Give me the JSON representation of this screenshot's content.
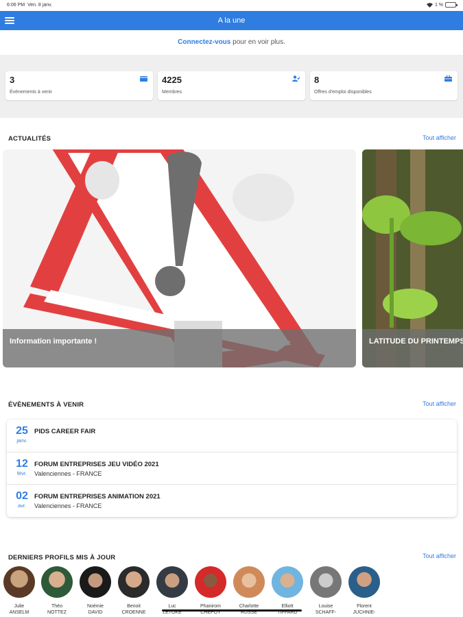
{
  "status_bar": {
    "time": "6:06 PM",
    "date": "Ven. 8 janv.",
    "battery": "1 %"
  },
  "header": {
    "title": "A la une"
  },
  "login": {
    "link": "Connectez-vous",
    "suffix": " pour en voir plus."
  },
  "stats": [
    {
      "value": "3",
      "label": "Évènements à venir",
      "icon": "calendar-icon"
    },
    {
      "value": "4225",
      "label": "Membres",
      "icon": "members-icon"
    },
    {
      "value": "8",
      "label": "Offres d'emploi disponibles",
      "icon": "briefcase-icon"
    }
  ],
  "news": {
    "title": "ACTUALITÉS",
    "see_all": "Tout afficher",
    "items": [
      {
        "caption": "Information importante !"
      },
      {
        "caption": "LATITUDE DU PRINTEMPS"
      }
    ]
  },
  "events": {
    "title": "ÉVÈNEMENTS À VENIR",
    "see_all": "Tout afficher",
    "items": [
      {
        "day": "25",
        "month": "janv.",
        "name": "PIDS CAREER FAIR",
        "location": ""
      },
      {
        "day": "12",
        "month": "févr.",
        "name": "FORUM ENTREPRISES JEU VIDÉO 2021",
        "location": "Valenciennes - FRANCE"
      },
      {
        "day": "02",
        "month": "avr.",
        "name": "FORUM ENTREPRISES ANIMATION 2021",
        "location": "Valenciennes - FRANCE"
      }
    ]
  },
  "profiles": {
    "title": "DERNIERS PROFILS MIS À JOUR",
    "see_all": "Tout afficher",
    "items": [
      {
        "first": "Julie",
        "last": "ANSELM"
      },
      {
        "first": "Théo",
        "last": "NOTTEZ"
      },
      {
        "first": "Noémie",
        "last": "DAVID"
      },
      {
        "first": "Benoit",
        "last": "CROENNE"
      },
      {
        "first": "Luc",
        "last": "LETOKE"
      },
      {
        "first": "Phanirom",
        "last": "CHEPOY"
      },
      {
        "first": "Charlotte",
        "last": "RUSSE"
      },
      {
        "first": "Elliott",
        "last": "TIFFARD"
      },
      {
        "first": "Louise",
        "last": "SCHAFF-"
      },
      {
        "first": "Florent",
        "last": "JUCHNIE-"
      }
    ]
  },
  "colors": {
    "accent": "#2f7de1",
    "band": "#efefef"
  }
}
